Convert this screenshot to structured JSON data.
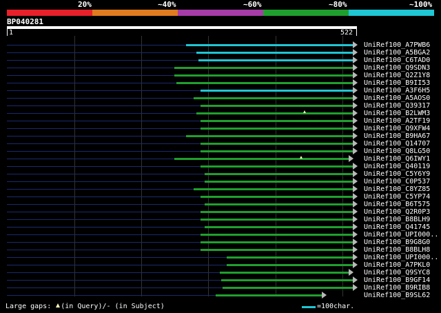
{
  "legend": {
    "labels": [
      "20%",
      "~40%",
      "~60%",
      "~80%",
      "~100%"
    ],
    "colors": [
      "#e8202a",
      "#e07b20",
      "#a63ca8",
      "#1fa02e",
      "#1fc7d4"
    ]
  },
  "query": {
    "name": "BP040281",
    "start": "1",
    "end": "522"
  },
  "colors": {
    "cyan": "#1fc7d4",
    "green": "#1fa02e",
    "prefix_line": "#1b2a6e",
    "gap_marker": "#ffffbb"
  },
  "hits": [
    {
      "name": "UniRef100_A7PWB6",
      "band": "~100%"
    },
    {
      "name": "UniRef100_A5BGA2",
      "band": "~100%"
    },
    {
      "name": "UniRef100_C6TAD0",
      "band": "~100%"
    },
    {
      "name": "UniRef100_Q9SDN3",
      "band": "~80%"
    },
    {
      "name": "UniRef100_Q2Z1Y8",
      "band": "~80%"
    },
    {
      "name": "UniRef100_B9II53",
      "band": "~80%"
    },
    {
      "name": "UniRef100_A3F6H5",
      "band": "~100%"
    },
    {
      "name": "UniRef100_A5AOS0",
      "band": "~80%"
    },
    {
      "name": "UniRef100_Q39317",
      "band": "~80%"
    },
    {
      "name": "UniRef100_B2LWM3",
      "band": "~80%",
      "query_gap": true
    },
    {
      "name": "UniRef100_A2TF19",
      "band": "~80%"
    },
    {
      "name": "UniRef100_Q9XFW4",
      "band": "~80%"
    },
    {
      "name": "UniRef100_B9HA67",
      "band": "~80%"
    },
    {
      "name": "UniRef100_Q14707",
      "band": "~80%"
    },
    {
      "name": "UniRef100_Q8LG50",
      "band": "~80%"
    },
    {
      "name": "UniRef100_Q6IWY1",
      "band": "~80%",
      "query_gap": true
    },
    {
      "name": "UniRef100_Q40119",
      "band": "~80%"
    },
    {
      "name": "UniRef100_C5Y6Y9",
      "band": "~80%"
    },
    {
      "name": "UniRef100_C0P537",
      "band": "~80%"
    },
    {
      "name": "UniRef100_C8YZ85",
      "band": "~80%"
    },
    {
      "name": "UniRef100_C5YP74",
      "band": "~80%"
    },
    {
      "name": "UniRef100_B6T575",
      "band": "~80%"
    },
    {
      "name": "UniRef100_Q2R0P3",
      "band": "~80%"
    },
    {
      "name": "UniRef100_B8BLH9",
      "band": "~80%"
    },
    {
      "name": "UniRef100_Q41745",
      "band": "~80%"
    },
    {
      "name": "UniRef100_UPI000..",
      "band": "~80%"
    },
    {
      "name": "UniRef100_B9G8G0",
      "band": "~80%"
    },
    {
      "name": "UniRef100_B8BLH8",
      "band": "~80%"
    },
    {
      "name": "UniRef100_UPI000..",
      "band": "~80%"
    },
    {
      "name": "UniRef100_A7PKL0",
      "band": "~80%"
    },
    {
      "name": "UniRef100_Q9SYC8",
      "band": "~80%"
    },
    {
      "name": "UniRef100_B9GF14",
      "band": "~80%"
    },
    {
      "name": "UniRef100_B9RIB8",
      "band": "~80%"
    },
    {
      "name": "UniRef100_B9SL62",
      "band": "~80%"
    }
  ],
  "footer": {
    "large_gaps": "Large gaps:",
    "in_query": "(in Query)/",
    "in_subject": "- (in Subject)",
    "scale": "=100char."
  }
}
